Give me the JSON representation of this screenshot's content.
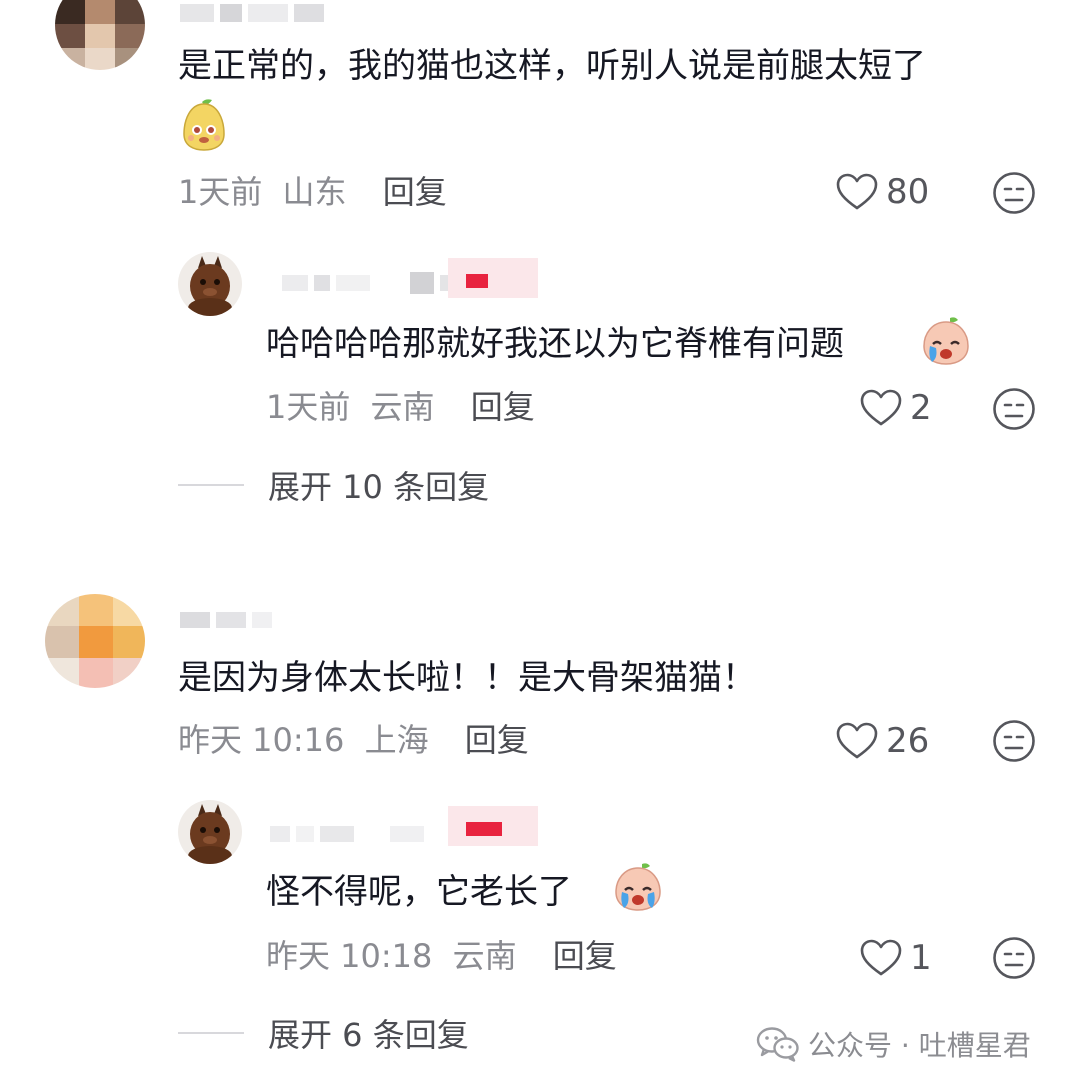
{
  "watermark": {
    "text": "公众号 · 吐槽星君",
    "icon": "wechat-icon"
  },
  "comments": [
    {
      "text": "是正常的，我的猫也这样，听别人说是前腿太短了",
      "emoji": "pear-face-emoji",
      "time": "1天前",
      "location": "山东",
      "reply_label": "回复",
      "likes": "80"
    },
    {
      "text": "哈哈哈哈那就好我还以为它脊椎有问题",
      "emoji": "crying-face-emoji",
      "time": "1天前",
      "location": "云南",
      "reply_label": "回复",
      "likes": "2"
    },
    {
      "text": "是因为身体太长啦！！是大骨架猫猫！",
      "time": "昨天 10:16",
      "location": "上海",
      "reply_label": "回复",
      "likes": "26"
    },
    {
      "text": "怪不得呢，它老长了",
      "emoji": "crying-face-emoji",
      "time": "昨天 10:18",
      "location": "云南",
      "reply_label": "回复",
      "likes": "1"
    }
  ],
  "expand_replies": [
    {
      "label": "展开 10 条回复"
    },
    {
      "label": "展开 6 条回复"
    }
  ],
  "colors": {
    "meta_gray": "#8a8b91",
    "author_badge_red": "#e8233f",
    "text_dark": "#161823"
  }
}
